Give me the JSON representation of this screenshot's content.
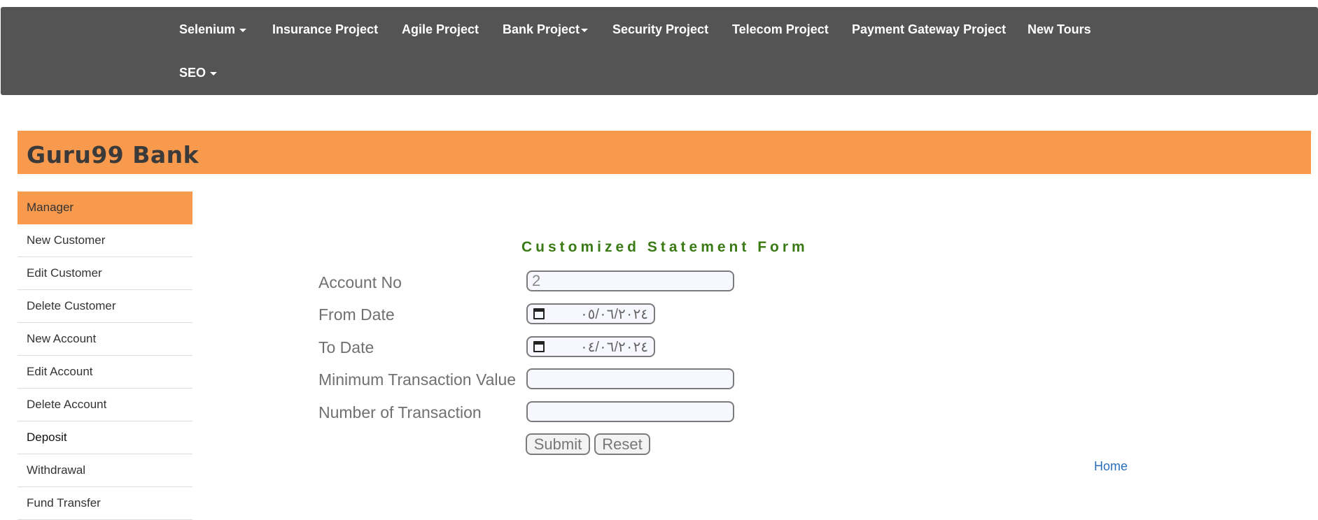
{
  "nav": {
    "items": [
      {
        "label": "Selenium",
        "caret": true
      },
      {
        "label": "Insurance Project",
        "caret": false
      },
      {
        "label": "Agile Project",
        "caret": false
      },
      {
        "label": "Bank Project",
        "caret": true
      },
      {
        "label": "Security Project",
        "caret": false
      },
      {
        "label": "Telecom Project",
        "caret": false
      },
      {
        "label": "Payment Gateway Project",
        "caret": false
      },
      {
        "label": "New Tours",
        "caret": false
      },
      {
        "label": "SEO",
        "caret": true
      }
    ]
  },
  "banner": {
    "title": "Guru99 Bank"
  },
  "sidebar": {
    "items": [
      {
        "label": "Manager"
      },
      {
        "label": "New Customer"
      },
      {
        "label": "Edit Customer"
      },
      {
        "label": "Delete Customer"
      },
      {
        "label": "New Account"
      },
      {
        "label": "Edit Account"
      },
      {
        "label": "Delete Account"
      },
      {
        "label": "Deposit"
      },
      {
        "label": "Withdrawal"
      },
      {
        "label": "Fund Transfer"
      }
    ]
  },
  "form": {
    "title": "Customized Statement Form",
    "fields": {
      "account_no": {
        "label": "Account No",
        "value": "2"
      },
      "from_date": {
        "label": "From Date",
        "value": "٠٥/٠٦/٢٠٢٤"
      },
      "to_date": {
        "label": "To Date",
        "value": "٠٤/٠٦/٢٠٢٤"
      },
      "min_value": {
        "label": "Minimum Transaction Value",
        "value": ""
      },
      "num_transactions": {
        "label": "Number of Transaction",
        "value": ""
      }
    },
    "submit_label": "Submit",
    "reset_label": "Reset"
  },
  "home_link": "Home",
  "colors": {
    "navbar": "#545454",
    "accent": "#f79a4e",
    "form_title": "#3a7a14",
    "link": "#2a6ebb"
  },
  "icons": {
    "dropdown": "caret-down-icon",
    "date": "calendar-icon"
  }
}
